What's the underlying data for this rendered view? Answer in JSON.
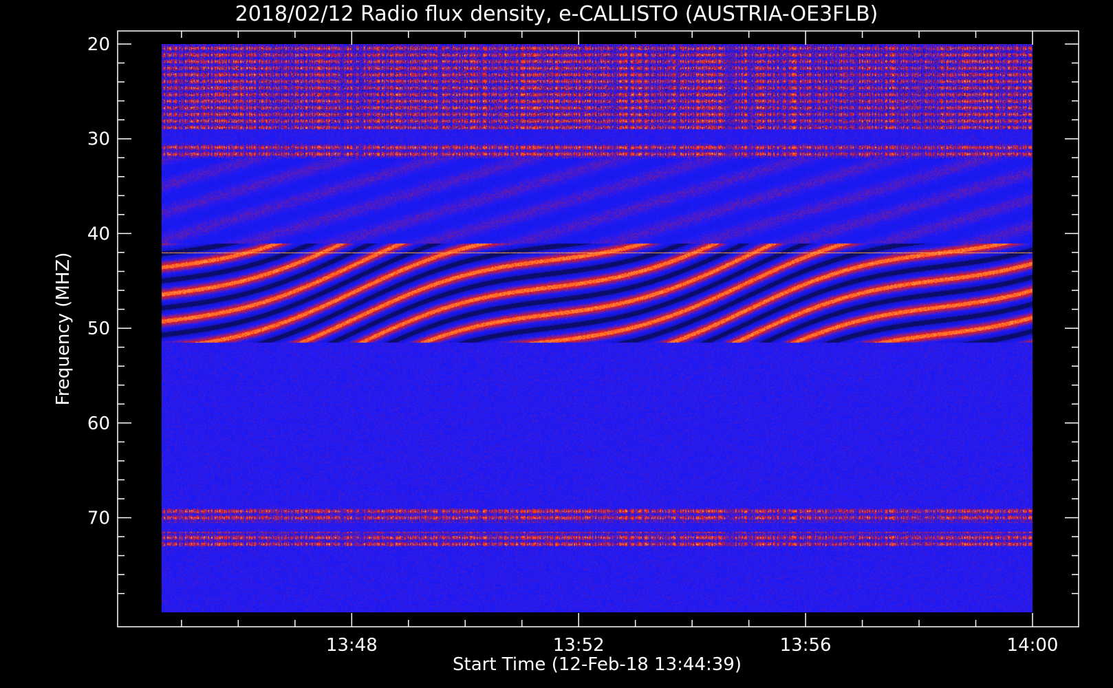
{
  "chart_data": {
    "type": "heatmap",
    "title": "2018/02/12  Radio flux density, e-CALLISTO (AUSTRIA-OE3FLB)",
    "xlabel": "Start Time (12-Feb-18 13:44:39)",
    "ylabel": "Frequency (MHZ)",
    "xlim": [
      "13:44:39",
      "14:00:00"
    ],
    "ylim": [
      20,
      80
    ],
    "y_inverted": true,
    "x_ticks": [
      "13:48",
      "13:52",
      "13:56",
      "14:00"
    ],
    "y_ticks": [
      20,
      30,
      40,
      50,
      60,
      70
    ],
    "colors": {
      "background": "#000000",
      "low": "#1a1aff",
      "mid": "#ff2000",
      "high": "#ffff80",
      "axis": "#ffffff"
    },
    "features": {
      "interference_bands_mhz": [
        [
          20,
          29
        ],
        [
          30.5,
          32
        ],
        [
          69,
          70.5
        ],
        [
          71.5,
          73
        ]
      ],
      "carrier_line_mhz": 42,
      "drifting_band_region_mhz": [
        41,
        51.5
      ]
    }
  }
}
